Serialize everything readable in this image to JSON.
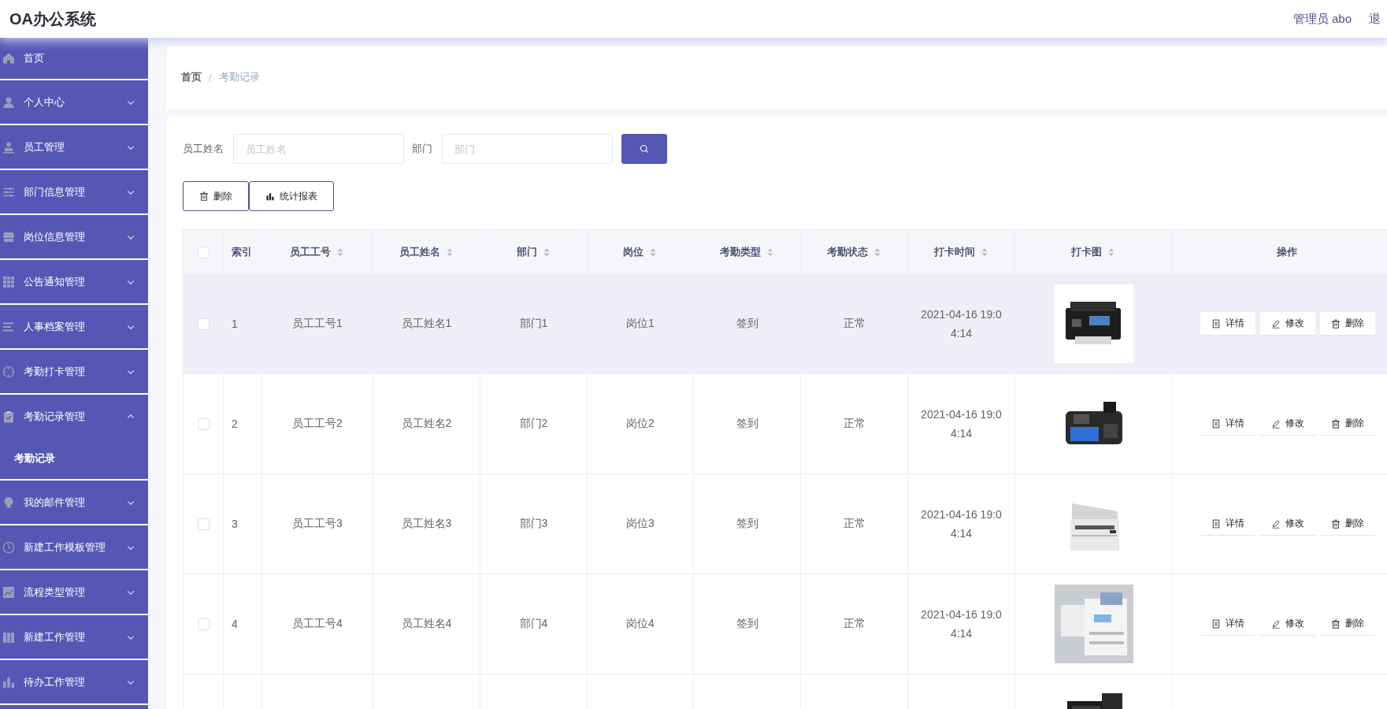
{
  "header": {
    "title": "OA办公系统",
    "user": "管理员 abo",
    "logout": "退"
  },
  "sidebar": {
    "items": [
      {
        "label": "首页",
        "kind": "link"
      },
      {
        "label": "个人中心",
        "kind": "submenu",
        "expanded": false
      },
      {
        "label": "员工管理",
        "kind": "submenu",
        "expanded": false
      },
      {
        "label": "部门信息管理",
        "kind": "submenu",
        "expanded": false
      },
      {
        "label": "岗位信息管理",
        "kind": "submenu",
        "expanded": false
      },
      {
        "label": "公告通知管理",
        "kind": "submenu",
        "expanded": false
      },
      {
        "label": "人事档案管理",
        "kind": "submenu",
        "expanded": false
      },
      {
        "label": "考勤打卡管理",
        "kind": "submenu",
        "expanded": false
      },
      {
        "label": "考勤记录管理",
        "kind": "submenu",
        "expanded": true,
        "children": [
          {
            "label": "考勤记录",
            "selected": true
          }
        ]
      },
      {
        "label": "我的邮件管理",
        "kind": "submenu",
        "expanded": false
      },
      {
        "label": "新建工作模板管理",
        "kind": "submenu",
        "expanded": false
      },
      {
        "label": "流程类型管理",
        "kind": "submenu",
        "expanded": false
      },
      {
        "label": "新建工作管理",
        "kind": "submenu",
        "expanded": false
      },
      {
        "label": "待办工作管理",
        "kind": "submenu",
        "expanded": false
      }
    ]
  },
  "breadcrumb": {
    "items": [
      "首页",
      "考勤记录"
    ],
    "separator": "/"
  },
  "search": {
    "fields": [
      {
        "label": "员工姓名",
        "placeholder": "员工姓名"
      },
      {
        "label": "部门",
        "placeholder": "部门"
      }
    ]
  },
  "toolbar": {
    "buttons": [
      {
        "label": "删除",
        "kind": "delete"
      },
      {
        "label": "统计报表",
        "kind": "report"
      }
    ]
  },
  "table": {
    "columns": [
      {
        "kind": "checkbox",
        "checked": false
      },
      {
        "kind": "plain",
        "label": "索引"
      },
      {
        "kind": "sortable",
        "label": "员工工号"
      },
      {
        "kind": "sortable",
        "label": "员工姓名"
      },
      {
        "kind": "sortable",
        "label": "部门"
      },
      {
        "kind": "sortable",
        "label": "岗位"
      },
      {
        "kind": "sortable",
        "label": "考勤类型"
      },
      {
        "kind": "sortable",
        "label": "考勤状态"
      },
      {
        "kind": "sortable",
        "label": "打卡时间"
      },
      {
        "kind": "sortable",
        "label": "打卡图"
      },
      {
        "kind": "plain",
        "label": "操作"
      }
    ],
    "rows": [
      {
        "checked": false,
        "highlighted": true,
        "cells": [
          "1",
          "员工工号1",
          "员工姓名1",
          "部门1",
          "岗位1",
          "签到",
          "正常",
          "2021-04-16 19:04:14"
        ],
        "image": {
          "kind": "picture"
        },
        "actions": [
          {
            "label": "详情",
            "kind": "detail"
          },
          {
            "label": "修改",
            "kind": "edit"
          },
          {
            "label": "删除",
            "kind": "delete"
          }
        ]
      },
      {
        "checked": false,
        "highlighted": false,
        "cells": [
          "2",
          "员工工号2",
          "员工姓名2",
          "部门2",
          "岗位2",
          "签到",
          "正常",
          "2021-04-16 19:04:14"
        ],
        "image": {
          "kind": "picture"
        },
        "actions": [
          {
            "label": "详情",
            "kind": "detail"
          },
          {
            "label": "修改",
            "kind": "edit"
          },
          {
            "label": "删除",
            "kind": "delete"
          }
        ]
      },
      {
        "checked": false,
        "highlighted": false,
        "cells": [
          "3",
          "员工工号3",
          "员工姓名3",
          "部门3",
          "岗位3",
          "签到",
          "正常",
          "2021-04-16 19:04:14"
        ],
        "image": {
          "kind": "picture"
        },
        "actions": [
          {
            "label": "详情",
            "kind": "detail"
          },
          {
            "label": "修改",
            "kind": "edit"
          },
          {
            "label": "删除",
            "kind": "delete"
          }
        ]
      },
      {
        "checked": false,
        "highlighted": false,
        "cells": [
          "4",
          "员工工号4",
          "员工姓名4",
          "部门4",
          "岗位4",
          "签到",
          "正常",
          "2021-04-16 19:04:14"
        ],
        "image": {
          "kind": "picture"
        },
        "actions": [
          {
            "label": "详情",
            "kind": "detail"
          },
          {
            "label": "修改",
            "kind": "edit"
          },
          {
            "label": "删除",
            "kind": "delete"
          }
        ]
      },
      {
        "image": {
          "kind": "picture"
        }
      }
    ]
  }
}
